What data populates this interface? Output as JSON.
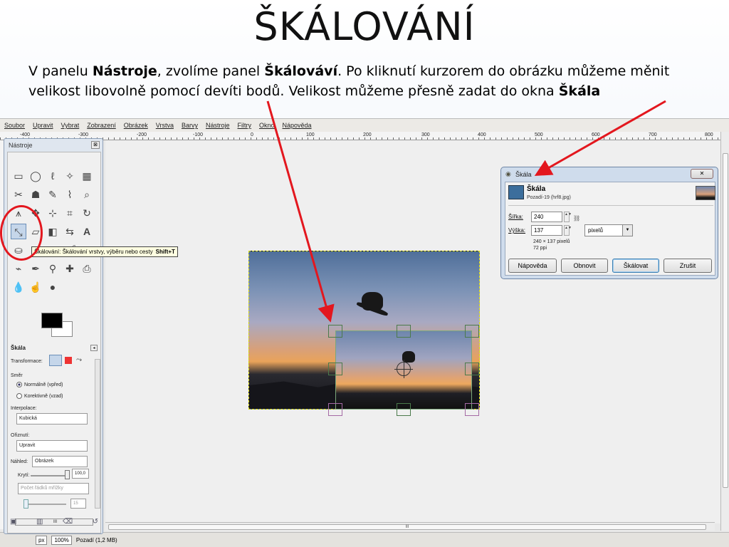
{
  "slide": {
    "title": "ŠKÁLOVÁNÍ",
    "desc": {
      "p1": "V panelu ",
      "b1": "Nástroje",
      "p2": ", zvolíme panel ",
      "b2": "Škálováví",
      "p3": ". Po kliknutí kurzorem do obrázku můžeme měnit velikost libovolně pomocí devíti bodů. Velikost můžeme přesně zadat do okna ",
      "b3": "Škála"
    }
  },
  "menubar": [
    "Soubor",
    "Upravit",
    "Vybrat",
    "Zobrazení",
    "Obrázek",
    "Vrstva",
    "Barvy",
    "Nástroje",
    "Filtry",
    "Okno",
    "Nápověda"
  ],
  "ruler": [
    "-400",
    "-300",
    "-200",
    "-100",
    "0",
    "100",
    "200",
    "300",
    "400",
    "500",
    "600",
    "700",
    "800"
  ],
  "toolbox": {
    "title": "Nástroje",
    "close": "⊠",
    "tooltip": "Škálování: Škálování vrstvy, výběru nebo cesty",
    "tooltip_key": "Shift+T",
    "options_title": "Škála",
    "transform_label": "Transformace:",
    "direction_label": "Směr",
    "dir_forward": "Normálně (vpřed)",
    "dir_backward": "Korektivně (vzad)",
    "interp_label": "Interpolace:",
    "interp_value": "Kubická",
    "clip_label": "Ořiznutí:",
    "clip_value": "Upravit",
    "preview_label": "Náhled:",
    "preview_value": "Obrázek",
    "opacity_label": "Krytí:",
    "opacity_value": "100,0",
    "grid_placeholder": "Počet řádků mřížky",
    "grid_value": "15",
    "hscroll": "III"
  },
  "statusbar": {
    "unit": "px",
    "zoom": "100%",
    "info": "Pozadí (1,2 MB)"
  },
  "canvas_scroll": "III",
  "dialog": {
    "title": "Škála",
    "close": "✕",
    "head_title": "Škála",
    "head_sub": "Pozadí-19 (hrf8.jpg)",
    "width_label": "Šířka:",
    "width_value": "240",
    "height_label": "Výška:",
    "height_value": "137",
    "unit": "pixelů",
    "info1": "240 × 137 pixelů",
    "info2": "72 ppi",
    "btn_help": "Nápověda",
    "btn_reset": "Obnovit",
    "btn_scale": "Škálovat",
    "btn_cancel": "Zrušit"
  }
}
